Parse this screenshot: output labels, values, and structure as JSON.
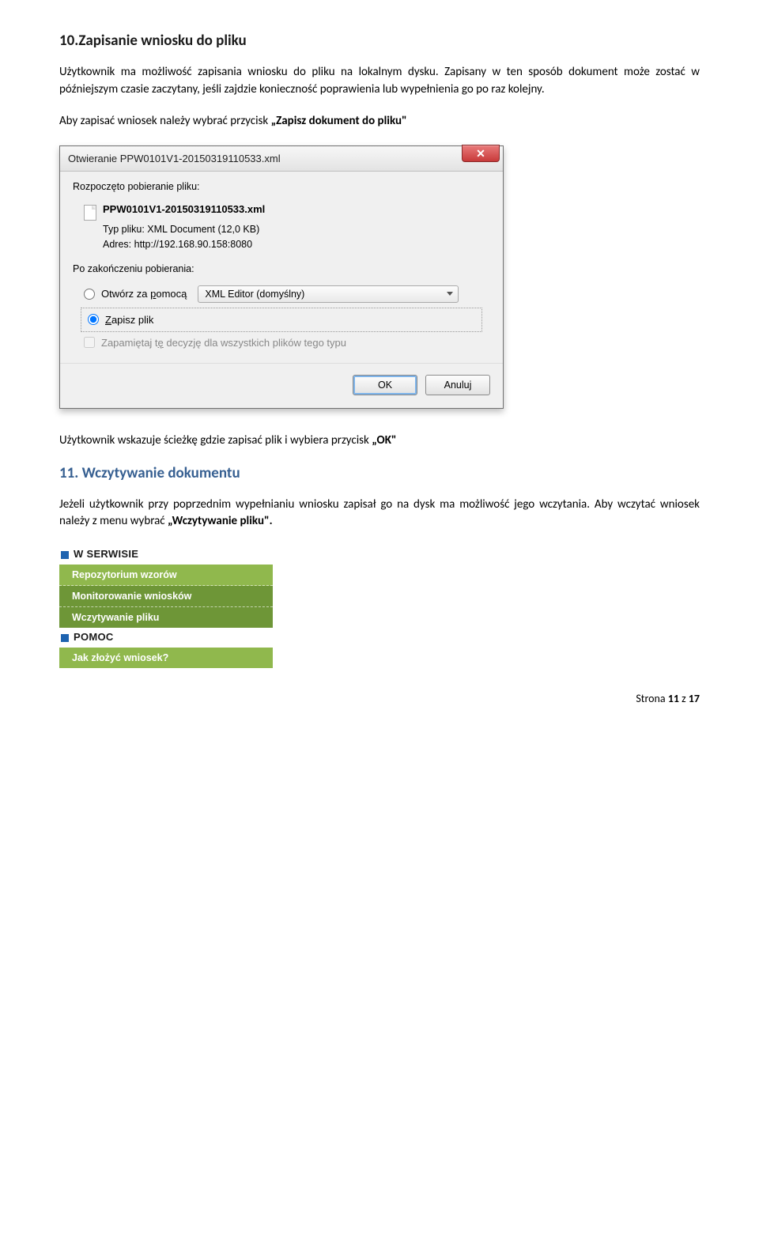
{
  "section10": {
    "heading": "10.Zapisanie wniosku do pliku",
    "p1": "Użytkownik ma możliwość zapisania wniosku do pliku na lokalnym dysku. Zapisany w ten sposób dokument może zostać w późniejszym czasie zaczytany, jeśli zajdzie konieczność poprawienia lub wypełnienia go po raz kolejny.",
    "p2_prefix": "Aby zapisać wniosek należy wybrać przycisk ",
    "p2_bold": "„Zapisz dokument do pliku\""
  },
  "dialog": {
    "title": "Otwieranie PPW0101V1-20150319110533.xml",
    "closeGlyph": "✕",
    "startedLabel": "Rozpoczęto pobieranie pliku:",
    "fileName": "PPW0101V1-20150319110533.xml",
    "typeKey": "Typ pliku:",
    "typeVal": "XML Document (12,0 KB)",
    "addrKey": "Adres:",
    "addrVal": "http://192.168.90.158:8080",
    "afterLabel": "Po zakończeniu pobierania:",
    "openWithPrefix": "Otwórz za ",
    "openWithUnder": "p",
    "openWithSuffix": "omocą",
    "comboValue": "XML Editor (domyślny)",
    "saveUnder": "Z",
    "saveSuffix": "apisz plik",
    "rememberPrefix": "Zapamiętaj t",
    "rememberUnder": "ę",
    "rememberSuffix": " decyzję dla wszystkich plików tego typu",
    "ok": "OK",
    "cancel": "Anuluj"
  },
  "afterDialog": {
    "prefix": "Użytkownik wskazuje ścieżkę gdzie zapisać plik i wybiera przycisk  ",
    "bold": "„OK\""
  },
  "section11": {
    "heading": "11. Wczytywanie dokumentu",
    "p1_prefix": "Jeżeli użytkownik przy poprzednim wypełnianiu wniosku zapisał go na dysk ma możliwość jego wczytania. Aby wczytać wniosek należy z menu wybrać ",
    "p1_bold": "„Wczytywanie pliku\".",
    "menuHeader1": "W SERWISIE",
    "menuItems": [
      "Repozytorium wzorów",
      "Monitorowanie wniosków",
      "Wczytywanie pliku"
    ],
    "menuHeader2": "POMOC",
    "menuItems2": [
      "Jak złożyć wniosek?"
    ]
  },
  "footer": {
    "label": "Strona ",
    "page": "11",
    "of": " z ",
    "total": "17"
  }
}
